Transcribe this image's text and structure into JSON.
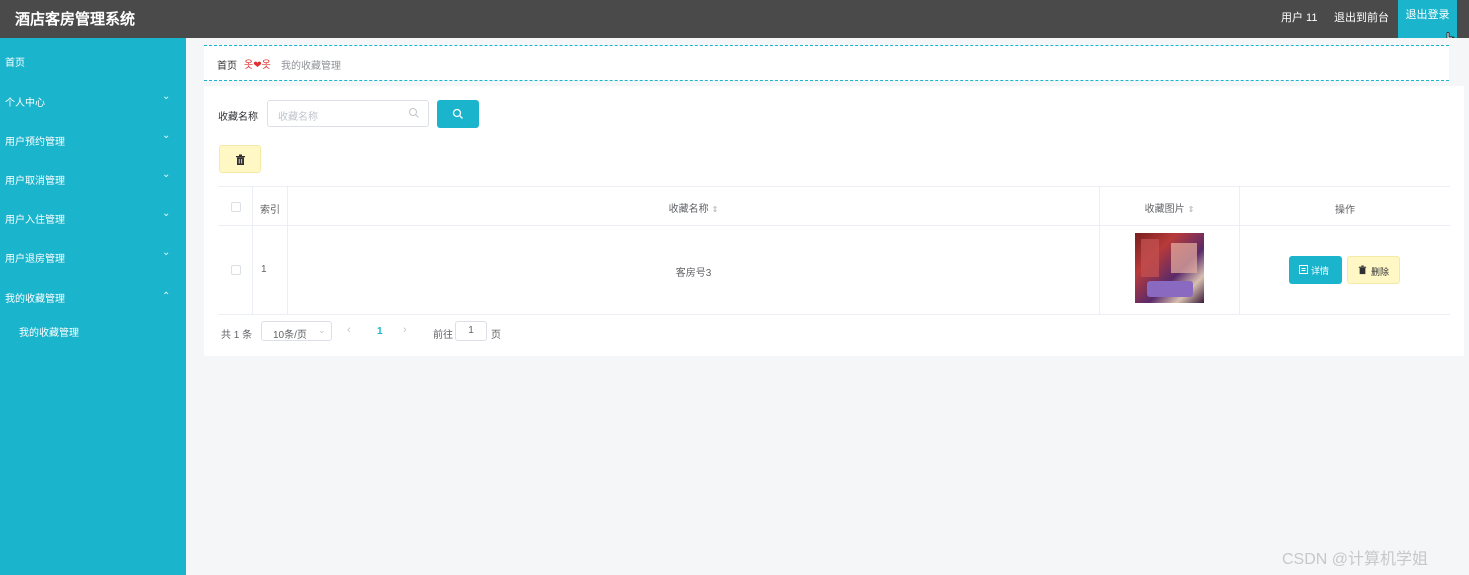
{
  "header": {
    "title": "酒店客房管理系统",
    "user": "用户 11",
    "front": "退出到前台",
    "logout": "退出登录"
  },
  "sidebar": {
    "items": [
      {
        "label": "首页"
      },
      {
        "label": "个人中心"
      },
      {
        "label": "用户预约管理"
      },
      {
        "label": "用户取消管理"
      },
      {
        "label": "用户入住管理"
      },
      {
        "label": "用户退房管理"
      },
      {
        "label": "我的收藏管理"
      }
    ],
    "sub_item": "我的收藏管理"
  },
  "breadcrumb": {
    "home": "首页",
    "current": "我的收藏管理"
  },
  "search": {
    "label": "收藏名称",
    "placeholder": "收藏名称"
  },
  "table": {
    "headers": {
      "index": "索引",
      "name": "收藏名称",
      "image": "收藏图片",
      "actions": "操作"
    },
    "rows": [
      {
        "index": "1",
        "name": "客房号3"
      }
    ],
    "detail_label": "详情",
    "delete_label": "删除"
  },
  "pagination": {
    "total": "共 1 条",
    "page_size": "10条/页",
    "current_page": "1",
    "goto_label": "前往",
    "goto_value": "1",
    "goto_unit": "页"
  },
  "watermark": "CSDN @计算机学姐",
  "colors": {
    "accent": "#1ab4cc",
    "header_bg": "#4a4a4a",
    "warning_btn": "#fff8c5"
  }
}
